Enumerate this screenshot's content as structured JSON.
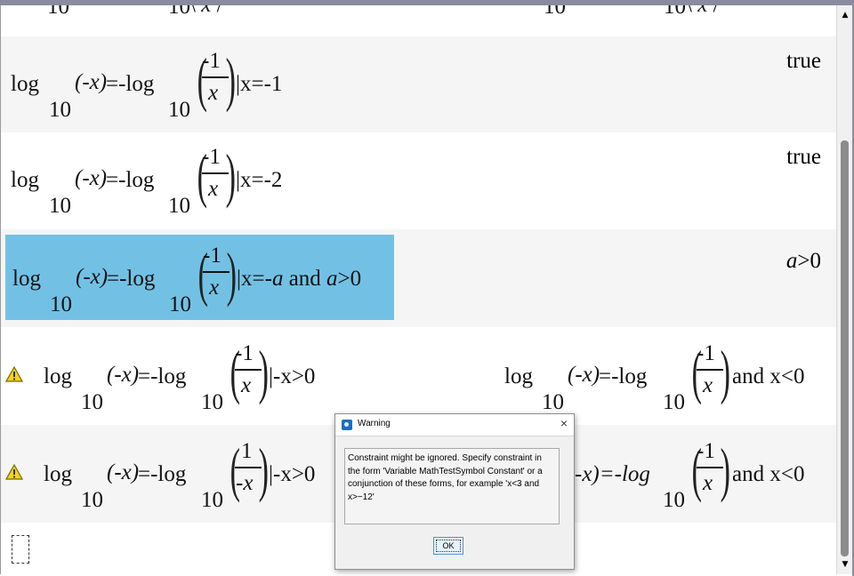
{
  "rows": {
    "partial": {
      "base_left": "10",
      "base_right": "10"
    },
    "row1": {
      "log1": "log",
      "base1": "10",
      "arg": "-x",
      "eq": "=-log",
      "base2": "10",
      "num": "-1",
      "den": "x",
      "cond": "|x=-1",
      "result": "true"
    },
    "row2": {
      "log1": "log",
      "base1": "10",
      "arg": "-x",
      "eq": "=-log",
      "base2": "10",
      "num": "-1",
      "den": "x",
      "cond": "|x=-2",
      "result": "true"
    },
    "row3": {
      "log1": "log",
      "base1": "10",
      "arg": "-x",
      "eq": "=-log",
      "base2": "10",
      "num": "-1",
      "den": "x",
      "cond_a": "|x=-",
      "cond_var": "a",
      "cond_and": " and ",
      "cond_var2": "a",
      "cond_gt": ">0",
      "result_var": "a",
      "result_rest": ">0"
    },
    "row4": {
      "log1": "log",
      "base1": "10",
      "arg": "-x",
      "eq": "=-log",
      "base2": "10",
      "num": "-1",
      "den": "x",
      "cond": "|-x>0",
      "r_log1": "log",
      "r_base1": "10",
      "r_arg": "-x",
      "r_eq": "=-log",
      "r_base2": "10",
      "r_num": "-1",
      "r_den": "x",
      "r_tail": " and x<0"
    },
    "row5": {
      "log1": "log",
      "base1": "10",
      "arg": "-x",
      "eq": "=-log",
      "base2": "10",
      "num": "1",
      "den": "-x",
      "cond": "|-x>0",
      "r_frag": "-x)=-log",
      "r_base2": "10",
      "r_num": "-1",
      "r_den": "x",
      "r_tail": " and x<0"
    }
  },
  "dialog": {
    "title": "Warning",
    "close": "×",
    "message": "Constraint might be ignored. Specify constraint in the form  'Variable MathTestSymbol Constant' or a conjunction of these forms, for example 'x<3 and x>−12'",
    "ok_label": "OK"
  },
  "scroll": {
    "up": "▲",
    "down": "▼"
  },
  "colors": {
    "highlight": "#72c1e5",
    "warning": "#f2d21b"
  }
}
